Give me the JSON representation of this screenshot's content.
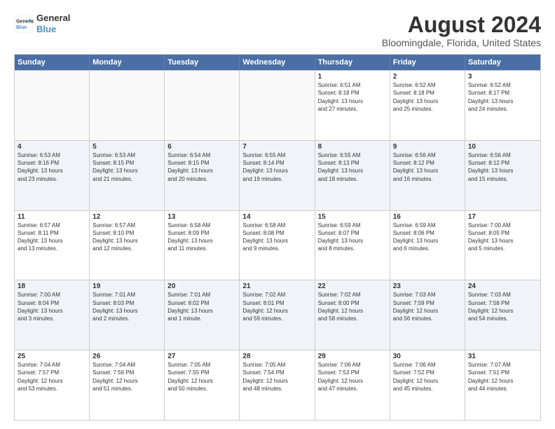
{
  "logo": {
    "line1": "General",
    "line2": "Blue"
  },
  "title": "August 2024",
  "subtitle": "Bloomingdale, Florida, United States",
  "header_days": [
    "Sunday",
    "Monday",
    "Tuesday",
    "Wednesday",
    "Thursday",
    "Friday",
    "Saturday"
  ],
  "weeks": [
    {
      "cells": [
        {
          "day": "",
          "empty": true,
          "info": ""
        },
        {
          "day": "",
          "empty": true,
          "info": ""
        },
        {
          "day": "",
          "empty": true,
          "info": ""
        },
        {
          "day": "",
          "empty": true,
          "info": ""
        },
        {
          "day": "1",
          "empty": false,
          "info": "Sunrise: 6:51 AM\nSunset: 8:18 PM\nDaylight: 13 hours\nand 27 minutes."
        },
        {
          "day": "2",
          "empty": false,
          "info": "Sunrise: 6:52 AM\nSunset: 8:18 PM\nDaylight: 13 hours\nand 25 minutes."
        },
        {
          "day": "3",
          "empty": false,
          "info": "Sunrise: 6:52 AM\nSunset: 8:17 PM\nDaylight: 13 hours\nand 24 minutes."
        }
      ]
    },
    {
      "cells": [
        {
          "day": "4",
          "empty": false,
          "info": "Sunrise: 6:53 AM\nSunset: 8:16 PM\nDaylight: 13 hours\nand 23 minutes."
        },
        {
          "day": "5",
          "empty": false,
          "info": "Sunrise: 6:53 AM\nSunset: 8:15 PM\nDaylight: 13 hours\nand 21 minutes."
        },
        {
          "day": "6",
          "empty": false,
          "info": "Sunrise: 6:54 AM\nSunset: 8:15 PM\nDaylight: 13 hours\nand 20 minutes."
        },
        {
          "day": "7",
          "empty": false,
          "info": "Sunrise: 6:55 AM\nSunset: 8:14 PM\nDaylight: 13 hours\nand 19 minutes."
        },
        {
          "day": "8",
          "empty": false,
          "info": "Sunrise: 6:55 AM\nSunset: 8:13 PM\nDaylight: 13 hours\nand 18 minutes."
        },
        {
          "day": "9",
          "empty": false,
          "info": "Sunrise: 6:56 AM\nSunset: 8:12 PM\nDaylight: 13 hours\nand 16 minutes."
        },
        {
          "day": "10",
          "empty": false,
          "info": "Sunrise: 6:56 AM\nSunset: 8:12 PM\nDaylight: 13 hours\nand 15 minutes."
        }
      ]
    },
    {
      "cells": [
        {
          "day": "11",
          "empty": false,
          "info": "Sunrise: 6:57 AM\nSunset: 8:11 PM\nDaylight: 13 hours\nand 13 minutes."
        },
        {
          "day": "12",
          "empty": false,
          "info": "Sunrise: 6:57 AM\nSunset: 8:10 PM\nDaylight: 13 hours\nand 12 minutes."
        },
        {
          "day": "13",
          "empty": false,
          "info": "Sunrise: 6:58 AM\nSunset: 8:09 PM\nDaylight: 13 hours\nand 11 minutes."
        },
        {
          "day": "14",
          "empty": false,
          "info": "Sunrise: 6:58 AM\nSunset: 8:08 PM\nDaylight: 13 hours\nand 9 minutes."
        },
        {
          "day": "15",
          "empty": false,
          "info": "Sunrise: 6:59 AM\nSunset: 8:07 PM\nDaylight: 13 hours\nand 8 minutes."
        },
        {
          "day": "16",
          "empty": false,
          "info": "Sunrise: 6:59 AM\nSunset: 8:06 PM\nDaylight: 13 hours\nand 6 minutes."
        },
        {
          "day": "17",
          "empty": false,
          "info": "Sunrise: 7:00 AM\nSunset: 8:05 PM\nDaylight: 13 hours\nand 5 minutes."
        }
      ]
    },
    {
      "cells": [
        {
          "day": "18",
          "empty": false,
          "info": "Sunrise: 7:00 AM\nSunset: 8:04 PM\nDaylight: 13 hours\nand 3 minutes."
        },
        {
          "day": "19",
          "empty": false,
          "info": "Sunrise: 7:01 AM\nSunset: 8:03 PM\nDaylight: 13 hours\nand 2 minutes."
        },
        {
          "day": "20",
          "empty": false,
          "info": "Sunrise: 7:01 AM\nSunset: 8:02 PM\nDaylight: 13 hours\nand 1 minute."
        },
        {
          "day": "21",
          "empty": false,
          "info": "Sunrise: 7:02 AM\nSunset: 8:01 PM\nDaylight: 12 hours\nand 59 minutes."
        },
        {
          "day": "22",
          "empty": false,
          "info": "Sunrise: 7:02 AM\nSunset: 8:00 PM\nDaylight: 12 hours\nand 58 minutes."
        },
        {
          "day": "23",
          "empty": false,
          "info": "Sunrise: 7:03 AM\nSunset: 7:59 PM\nDaylight: 12 hours\nand 56 minutes."
        },
        {
          "day": "24",
          "empty": false,
          "info": "Sunrise: 7:03 AM\nSunset: 7:58 PM\nDaylight: 12 hours\nand 54 minutes."
        }
      ]
    },
    {
      "cells": [
        {
          "day": "25",
          "empty": false,
          "info": "Sunrise: 7:04 AM\nSunset: 7:57 PM\nDaylight: 12 hours\nand 53 minutes."
        },
        {
          "day": "26",
          "empty": false,
          "info": "Sunrise: 7:04 AM\nSunset: 7:56 PM\nDaylight: 12 hours\nand 51 minutes."
        },
        {
          "day": "27",
          "empty": false,
          "info": "Sunrise: 7:05 AM\nSunset: 7:55 PM\nDaylight: 12 hours\nand 50 minutes."
        },
        {
          "day": "28",
          "empty": false,
          "info": "Sunrise: 7:05 AM\nSunset: 7:54 PM\nDaylight: 12 hours\nand 48 minutes."
        },
        {
          "day": "29",
          "empty": false,
          "info": "Sunrise: 7:06 AM\nSunset: 7:53 PM\nDaylight: 12 hours\nand 47 minutes."
        },
        {
          "day": "30",
          "empty": false,
          "info": "Sunrise: 7:06 AM\nSunset: 7:52 PM\nDaylight: 12 hours\nand 45 minutes."
        },
        {
          "day": "31",
          "empty": false,
          "info": "Sunrise: 7:07 AM\nSunset: 7:51 PM\nDaylight: 12 hours\nand 44 minutes."
        }
      ]
    }
  ]
}
